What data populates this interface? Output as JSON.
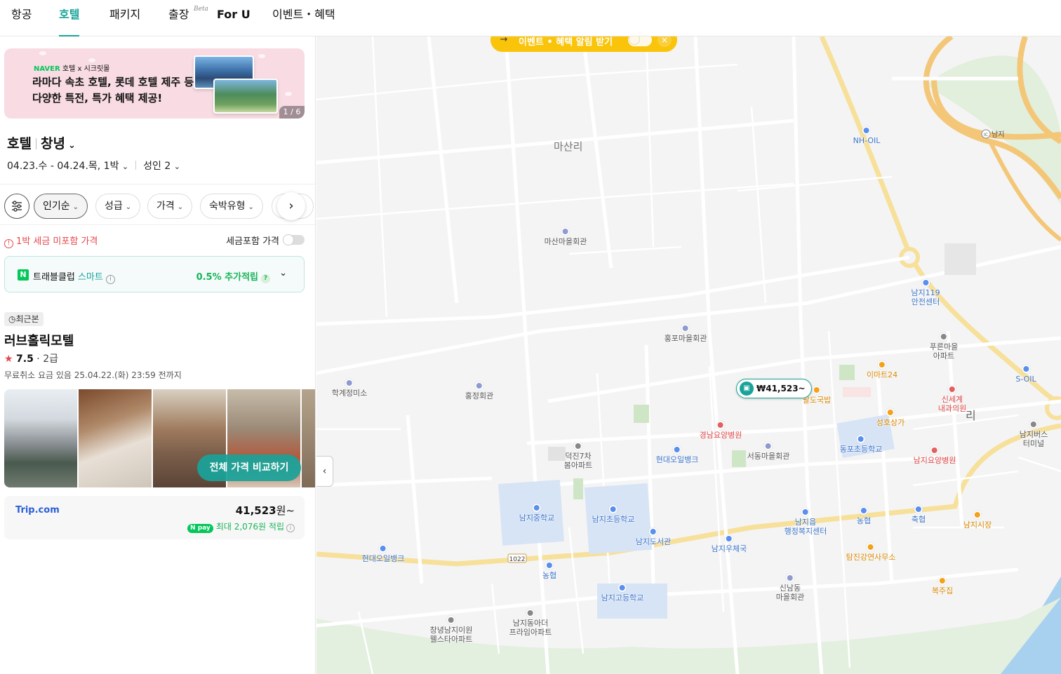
{
  "nav": {
    "tabs": [
      {
        "label": "항공"
      },
      {
        "label": "호텔"
      },
      {
        "label": "패키지"
      },
      {
        "label": "출장"
      },
      {
        "label": "For U"
      },
      {
        "label": "이벤트・혜택"
      }
    ],
    "beta": "Beta",
    "active_tab": "호텔"
  },
  "banner": {
    "brand": "NAVER",
    "brand_rest": "호텔 x 시크릿몰",
    "line1": "라마다 속초 호텔, 롯데 호텔 제주 등",
    "line2": "다양한 특전, 특가 혜택 제공!",
    "pager": "1 / 6"
  },
  "search": {
    "category": "호텔",
    "location": "창녕",
    "dates": "04.23.수 - 04.24.목, 1박",
    "guests": "성인 2"
  },
  "filters": {
    "sort": "인기순",
    "grade": "성급",
    "price": "가격",
    "type": "숙박유형"
  },
  "tax": {
    "warning": "1박 세금 미포함 가격",
    "toggle_label": "세금포함 가격"
  },
  "club": {
    "n": "N",
    "name": "트래블클럽",
    "smart": "스마트",
    "reward": "0.5% 추가적립"
  },
  "hotel": {
    "recent": "최근본",
    "name": "러브홀릭모텔",
    "score": "7.5",
    "grade": "2급",
    "cancel": "무료취소 요금 있음 25.04.22.(화) 23:59 전까지",
    "compare": "전체 가격 비교하기",
    "provider": "Trip.com",
    "price": "41,523",
    "price_unit": "원~",
    "pay_badge": "N pay",
    "pay_reward": "최대 2,076원 적립"
  },
  "map": {
    "alert": "이벤트 • 혜택 알림 받기",
    "pin_price": "₩41,523~",
    "area": "마산리",
    "pois": [
      {
        "label": "마산마을회관",
        "kind": ""
      },
      {
        "label": "홍포마을회관",
        "kind": ""
      },
      {
        "label": "학계정미소",
        "kind": ""
      },
      {
        "label": "홍정회관",
        "kind": ""
      },
      {
        "label": "NH-OIL",
        "kind": "blue"
      },
      {
        "label": "남지119\n안전센터",
        "kind": "blue"
      },
      {
        "label": "푸른마을\n아파트",
        "kind": "gray"
      },
      {
        "label": "이마트24",
        "kind": "orange"
      },
      {
        "label": "S-OIL",
        "kind": "blue"
      },
      {
        "label": "팔도국밥",
        "kind": "orange"
      },
      {
        "label": "신세계\n내과의원",
        "kind": "red"
      },
      {
        "label": "성호상가",
        "kind": "orange"
      },
      {
        "label": "경남요양병원",
        "kind": "red"
      },
      {
        "label": "동포초등학교",
        "kind": "blue"
      },
      {
        "label": "남지버스\n터미널",
        "kind": "gray"
      },
      {
        "label": "덕진7차\n봄아파트",
        "kind": "gray"
      },
      {
        "label": "현대오일뱅크",
        "kind": "blue"
      },
      {
        "label": "서동마을회관",
        "kind": ""
      },
      {
        "label": "남지요양병원",
        "kind": "red"
      },
      {
        "label": "남지중학교",
        "kind": "blue"
      },
      {
        "label": "남지초등학교",
        "kind": "blue"
      },
      {
        "label": "남지도서관",
        "kind": "blue"
      },
      {
        "label": "남지읍\n행정복지센터",
        "kind": "blue"
      },
      {
        "label": "농협",
        "kind": "blue"
      },
      {
        "label": "축협",
        "kind": "blue"
      },
      {
        "label": "남지시장",
        "kind": "orange"
      },
      {
        "label": "현대오일뱅크",
        "kind": "blue"
      },
      {
        "label": "농협",
        "kind": "blue"
      },
      {
        "label": "남지우체국",
        "kind": "blue"
      },
      {
        "label": "탐진강연사무소",
        "kind": "orange"
      },
      {
        "label": "신남동\n마을회관",
        "kind": ""
      },
      {
        "label": "복주집",
        "kind": "orange"
      },
      {
        "label": "남지고등학교",
        "kind": "blue"
      },
      {
        "label": "남지동아더\n프라임아파트",
        "kind": "gray"
      },
      {
        "label": "창녕남지이원\n웰스타아파트",
        "kind": "gray"
      }
    ],
    "road_number": "1022",
    "ic_label": "IC",
    "ic_name": "남지",
    "ri": "리"
  }
}
